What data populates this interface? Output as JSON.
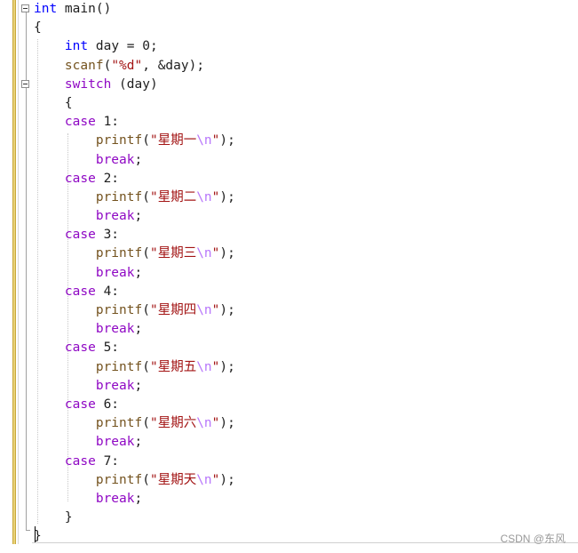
{
  "editor": {
    "lines": [
      [
        {
          "t": "int",
          "c": "kw"
        },
        {
          "t": " main()",
          "c": "plain"
        }
      ],
      [
        {
          "t": "{",
          "c": "plain"
        }
      ],
      [
        {
          "t": "    ",
          "c": "plain"
        },
        {
          "t": "int",
          "c": "kw"
        },
        {
          "t": " day = 0;",
          "c": "plain"
        }
      ],
      [
        {
          "t": "    ",
          "c": "plain"
        },
        {
          "t": "scanf",
          "c": "fn"
        },
        {
          "t": "(",
          "c": "plain"
        },
        {
          "t": "\"%d\"",
          "c": "str"
        },
        {
          "t": ", &day);",
          "c": "plain"
        }
      ],
      [
        {
          "t": "    ",
          "c": "plain"
        },
        {
          "t": "switch",
          "c": "ctl"
        },
        {
          "t": " (day)",
          "c": "plain"
        }
      ],
      [
        {
          "t": "    {",
          "c": "plain"
        }
      ],
      [
        {
          "t": "    ",
          "c": "plain"
        },
        {
          "t": "case",
          "c": "ctl"
        },
        {
          "t": " 1:",
          "c": "plain"
        }
      ],
      [
        {
          "t": "        ",
          "c": "plain"
        },
        {
          "t": "printf",
          "c": "fn"
        },
        {
          "t": "(",
          "c": "plain"
        },
        {
          "t": "\"星期一",
          "c": "str"
        },
        {
          "t": "\\n",
          "c": "esc"
        },
        {
          "t": "\"",
          "c": "str"
        },
        {
          "t": ");",
          "c": "plain"
        }
      ],
      [
        {
          "t": "        ",
          "c": "plain"
        },
        {
          "t": "break",
          "c": "ctl"
        },
        {
          "t": ";",
          "c": "plain"
        }
      ],
      [
        {
          "t": "    ",
          "c": "plain"
        },
        {
          "t": "case",
          "c": "ctl"
        },
        {
          "t": " 2:",
          "c": "plain"
        }
      ],
      [
        {
          "t": "        ",
          "c": "plain"
        },
        {
          "t": "printf",
          "c": "fn"
        },
        {
          "t": "(",
          "c": "plain"
        },
        {
          "t": "\"星期二",
          "c": "str"
        },
        {
          "t": "\\n",
          "c": "esc"
        },
        {
          "t": "\"",
          "c": "str"
        },
        {
          "t": ");",
          "c": "plain"
        }
      ],
      [
        {
          "t": "        ",
          "c": "plain"
        },
        {
          "t": "break",
          "c": "ctl"
        },
        {
          "t": ";",
          "c": "plain"
        }
      ],
      [
        {
          "t": "    ",
          "c": "plain"
        },
        {
          "t": "case",
          "c": "ctl"
        },
        {
          "t": " 3:",
          "c": "plain"
        }
      ],
      [
        {
          "t": "        ",
          "c": "plain"
        },
        {
          "t": "printf",
          "c": "fn"
        },
        {
          "t": "(",
          "c": "plain"
        },
        {
          "t": "\"星期三",
          "c": "str"
        },
        {
          "t": "\\n",
          "c": "esc"
        },
        {
          "t": "\"",
          "c": "str"
        },
        {
          "t": ");",
          "c": "plain"
        }
      ],
      [
        {
          "t": "        ",
          "c": "plain"
        },
        {
          "t": "break",
          "c": "ctl"
        },
        {
          "t": ";",
          "c": "plain"
        }
      ],
      [
        {
          "t": "    ",
          "c": "plain"
        },
        {
          "t": "case",
          "c": "ctl"
        },
        {
          "t": " 4:",
          "c": "plain"
        }
      ],
      [
        {
          "t": "        ",
          "c": "plain"
        },
        {
          "t": "printf",
          "c": "fn"
        },
        {
          "t": "(",
          "c": "plain"
        },
        {
          "t": "\"星期四",
          "c": "str"
        },
        {
          "t": "\\n",
          "c": "esc"
        },
        {
          "t": "\"",
          "c": "str"
        },
        {
          "t": ");",
          "c": "plain"
        }
      ],
      [
        {
          "t": "        ",
          "c": "plain"
        },
        {
          "t": "break",
          "c": "ctl"
        },
        {
          "t": ";",
          "c": "plain"
        }
      ],
      [
        {
          "t": "    ",
          "c": "plain"
        },
        {
          "t": "case",
          "c": "ctl"
        },
        {
          "t": " 5:",
          "c": "plain"
        }
      ],
      [
        {
          "t": "        ",
          "c": "plain"
        },
        {
          "t": "printf",
          "c": "fn"
        },
        {
          "t": "(",
          "c": "plain"
        },
        {
          "t": "\"星期五",
          "c": "str"
        },
        {
          "t": "\\n",
          "c": "esc"
        },
        {
          "t": "\"",
          "c": "str"
        },
        {
          "t": ");",
          "c": "plain"
        }
      ],
      [
        {
          "t": "        ",
          "c": "plain"
        },
        {
          "t": "break",
          "c": "ctl"
        },
        {
          "t": ";",
          "c": "plain"
        }
      ],
      [
        {
          "t": "    ",
          "c": "plain"
        },
        {
          "t": "case",
          "c": "ctl"
        },
        {
          "t": " 6:",
          "c": "plain"
        }
      ],
      [
        {
          "t": "        ",
          "c": "plain"
        },
        {
          "t": "printf",
          "c": "fn"
        },
        {
          "t": "(",
          "c": "plain"
        },
        {
          "t": "\"星期六",
          "c": "str"
        },
        {
          "t": "\\n",
          "c": "esc"
        },
        {
          "t": "\"",
          "c": "str"
        },
        {
          "t": ");",
          "c": "plain"
        }
      ],
      [
        {
          "t": "        ",
          "c": "plain"
        },
        {
          "t": "break",
          "c": "ctl"
        },
        {
          "t": ";",
          "c": "plain"
        }
      ],
      [
        {
          "t": "    ",
          "c": "plain"
        },
        {
          "t": "case",
          "c": "ctl"
        },
        {
          "t": " 7:",
          "c": "plain"
        }
      ],
      [
        {
          "t": "        ",
          "c": "plain"
        },
        {
          "t": "printf",
          "c": "fn"
        },
        {
          "t": "(",
          "c": "plain"
        },
        {
          "t": "\"星期天",
          "c": "str"
        },
        {
          "t": "\\n",
          "c": "esc"
        },
        {
          "t": "\"",
          "c": "str"
        },
        {
          "t": ");",
          "c": "plain"
        }
      ],
      [
        {
          "t": "        ",
          "c": "plain"
        },
        {
          "t": "break",
          "c": "ctl"
        },
        {
          "t": ";",
          "c": "plain"
        }
      ],
      [
        {
          "t": "    }",
          "c": "plain"
        }
      ],
      [
        {
          "t": "}",
          "c": "plain"
        }
      ]
    ],
    "colors": {
      "kw": "#0000ff",
      "fn": "#74531f",
      "ctl": "#8f08c4",
      "str": "#a31515",
      "esc": "#b776fb",
      "plain": "#1e1e1e"
    }
  },
  "watermark": "CSDN @东风"
}
